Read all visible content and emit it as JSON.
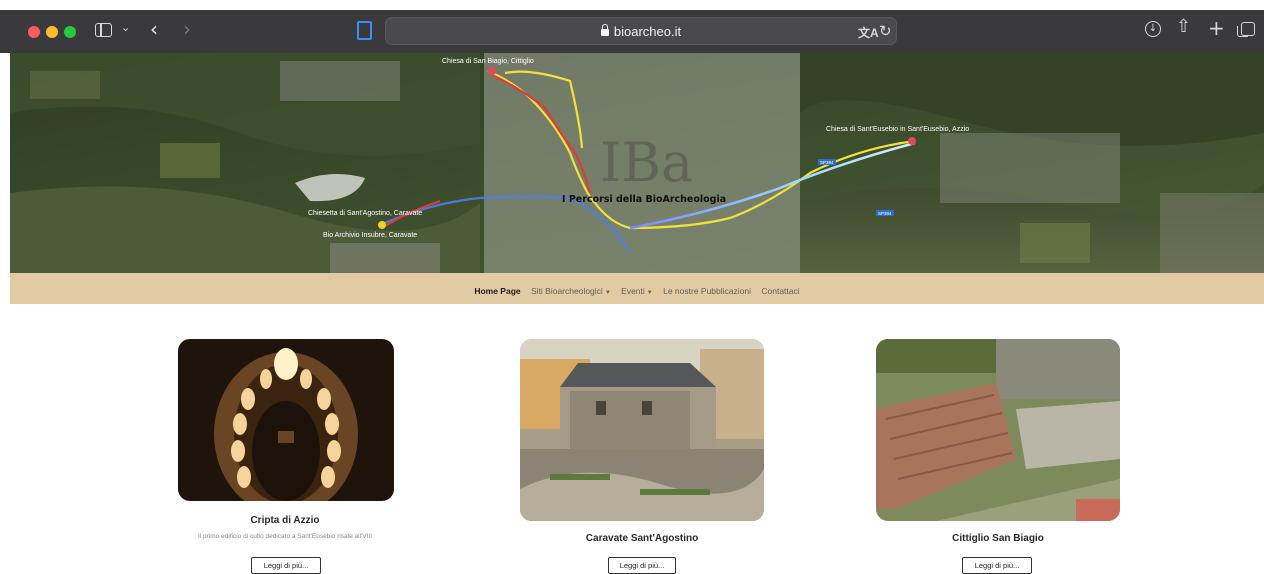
{
  "browser": {
    "url": "bioarcheo.it"
  },
  "hero": {
    "site_title": "I Percorsi della BioArcheologia",
    "logo_text": "IBa",
    "map_labels": {
      "top": "Chiesa di San Biagio, Cittiglio",
      "left_church": "Chiesetta di Sant'Agostino, Caravate",
      "left_archive": "Bio Archivio Insubre, Caravate",
      "right_church": "Chiesa di Sant'Eusebio in Sant'Eusebio, Azzio",
      "road_a": "SP394",
      "road_b": "SP394"
    }
  },
  "nav": {
    "items": [
      {
        "label": "Home Page",
        "active": true,
        "dropdown": false
      },
      {
        "label": "Siti Bioarcheologici",
        "active": false,
        "dropdown": true
      },
      {
        "label": "Eventi",
        "active": false,
        "dropdown": true
      },
      {
        "label": "Le nostre Pubblicazioni",
        "active": false,
        "dropdown": false
      },
      {
        "label": "Contattaci",
        "active": false,
        "dropdown": false
      }
    ]
  },
  "cards": [
    {
      "title": "Cripta di Azzio",
      "description": "Il primo edificio di culto dedicato a Sant'Eusebio risale all'VIII",
      "button": "Leggi di più..."
    },
    {
      "title": "Caravate Sant'Agostino",
      "description": "",
      "button": "Leggi di più..."
    },
    {
      "title": "Cittiglio San Biagio",
      "description": "",
      "button": "Leggi di più..."
    }
  ]
}
